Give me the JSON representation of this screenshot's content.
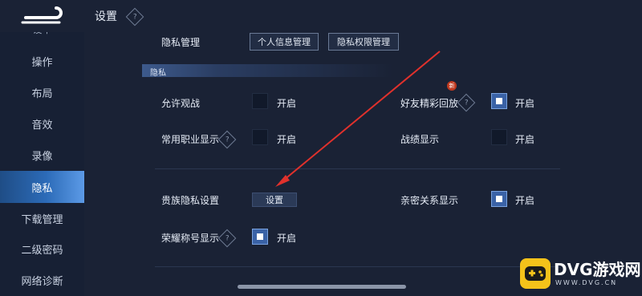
{
  "header": {
    "title": "设置",
    "help_icon": "question-icon"
  },
  "sidebar": {
    "items": [
      {
        "label": "操作"
      },
      {
        "label": "布局"
      },
      {
        "label": "音效"
      },
      {
        "label": "录像"
      },
      {
        "label": "隐私"
      },
      {
        "label": "下载管理"
      },
      {
        "label": "二级密码"
      },
      {
        "label": "网络诊断"
      }
    ],
    "partial_top": "设中",
    "active": "隐私",
    "accent": "#2c6bb8"
  },
  "privacy_management": {
    "label": "隐私管理",
    "buttons": [
      "个人信息管理",
      "隐私权限管理"
    ]
  },
  "section": {
    "title": "隐私"
  },
  "toggles": {
    "allow_spectate": {
      "label": "允许观战",
      "state_text": "开启",
      "checked": false
    },
    "highlight_replay": {
      "label": "好友精彩回放",
      "state_text": "开启",
      "checked": true,
      "badge": "新"
    },
    "common_role": {
      "label": "常用职业显示",
      "state_text": "开启",
      "checked": false
    },
    "battle_record": {
      "label": "战绩显示",
      "state_text": "开启",
      "checked": false
    },
    "intimate_relation": {
      "label": "亲密关系显示",
      "state_text": "开启",
      "checked": true
    },
    "honor_title": {
      "label": "荣耀称号显示",
      "state_text": "开启",
      "checked": true
    }
  },
  "noble_privacy": {
    "label": "贵族隐私设置",
    "button": "设置"
  },
  "watermark": {
    "brand": "DVG游戏网",
    "url": "WWW.DVG.CN",
    "color": "#f4c21a"
  },
  "annotation_color": "#e0312c"
}
